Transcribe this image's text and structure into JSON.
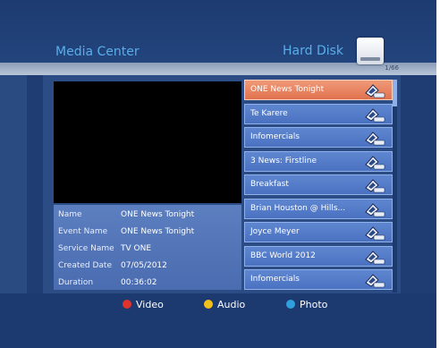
{
  "header": {
    "app_title": "Media Center",
    "device_title": "Hard Disk",
    "page_indicator": "1/66"
  },
  "info": {
    "rows": [
      {
        "key": "Name",
        "value": "ONE News Tonight"
      },
      {
        "key": "Event Name",
        "value": "ONE News Tonight"
      },
      {
        "key": "Service Name",
        "value": "TV ONE"
      },
      {
        "key": "Created Date",
        "value": "07/05/2012"
      },
      {
        "key": "Duration",
        "value": "00:36:02"
      }
    ]
  },
  "recordings": {
    "selected_index": 0,
    "items": [
      {
        "label": "ONE News Tonight"
      },
      {
        "label": "Te Karere"
      },
      {
        "label": "Infomercials"
      },
      {
        "label": "3 News: Firstline"
      },
      {
        "label": "Breakfast"
      },
      {
        "label": "Brian Houston @ Hills..."
      },
      {
        "label": "Joyce Meyer"
      },
      {
        "label": "BBC World 2012"
      },
      {
        "label": "Infomercials"
      }
    ]
  },
  "footer": {
    "legend": [
      {
        "label": "Video",
        "color": "#e0332b",
        "icon": "red-button-icon"
      },
      {
        "label": "Audio",
        "color": "#f2c21a",
        "icon": "yellow-button-icon"
      },
      {
        "label": "Photo",
        "color": "#2f9fe0",
        "icon": "blue-button-icon"
      }
    ]
  },
  "colors": {
    "accent_text": "#5aaee8",
    "selected_row": "#e0714e",
    "row": "#4a72c1"
  }
}
